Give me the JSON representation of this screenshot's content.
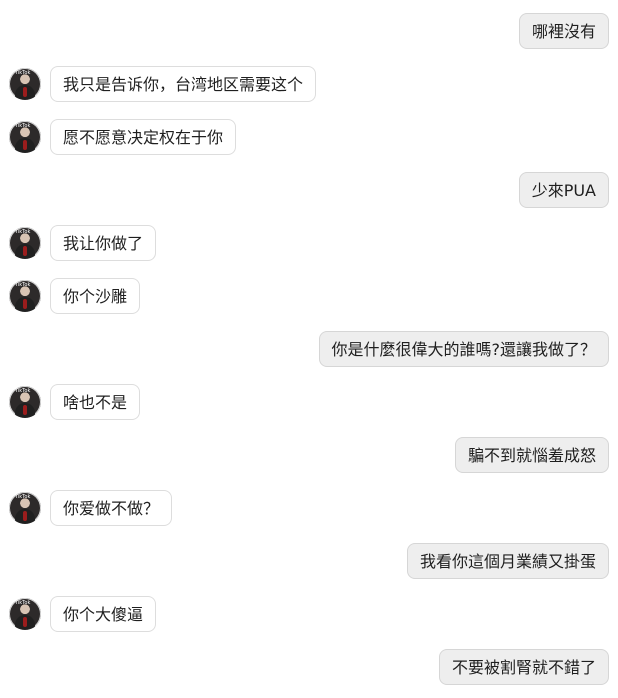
{
  "messages": [
    {
      "side": "right",
      "text": "哪裡沒有"
    },
    {
      "side": "left",
      "text": "我只是告诉你，台湾地区需要这个",
      "avatar": "tiktok-avatar"
    },
    {
      "side": "left",
      "text": "愿不愿意决定权在于你",
      "avatar": "tiktok-avatar"
    },
    {
      "side": "right",
      "text": "少來PUA"
    },
    {
      "side": "left",
      "text": "我让你做了",
      "avatar": "tiktok-avatar"
    },
    {
      "side": "left",
      "text": "你个沙雕",
      "avatar": "tiktok-avatar"
    },
    {
      "side": "right",
      "text": "你是什麼很偉大的誰嗎?還讓我做了？"
    },
    {
      "side": "left",
      "text": "啥也不是",
      "avatar": "tiktok-avatar"
    },
    {
      "side": "right",
      "text": "騙不到就惱羞成怒"
    },
    {
      "side": "left",
      "text": "你爱做不做？",
      "avatar": "tiktok-avatar"
    },
    {
      "side": "right",
      "text": "我看你這個月業績又掛蛋"
    },
    {
      "side": "left",
      "text": "你个大傻逼",
      "avatar": "tiktok-avatar"
    },
    {
      "side": "right",
      "text": "不要被割腎就不錯了"
    }
  ],
  "avatar_badge": "TikTok",
  "colors": {
    "left_bubble": "#ffffff",
    "right_bubble": "#eeeeee",
    "border": "#dddddd"
  }
}
